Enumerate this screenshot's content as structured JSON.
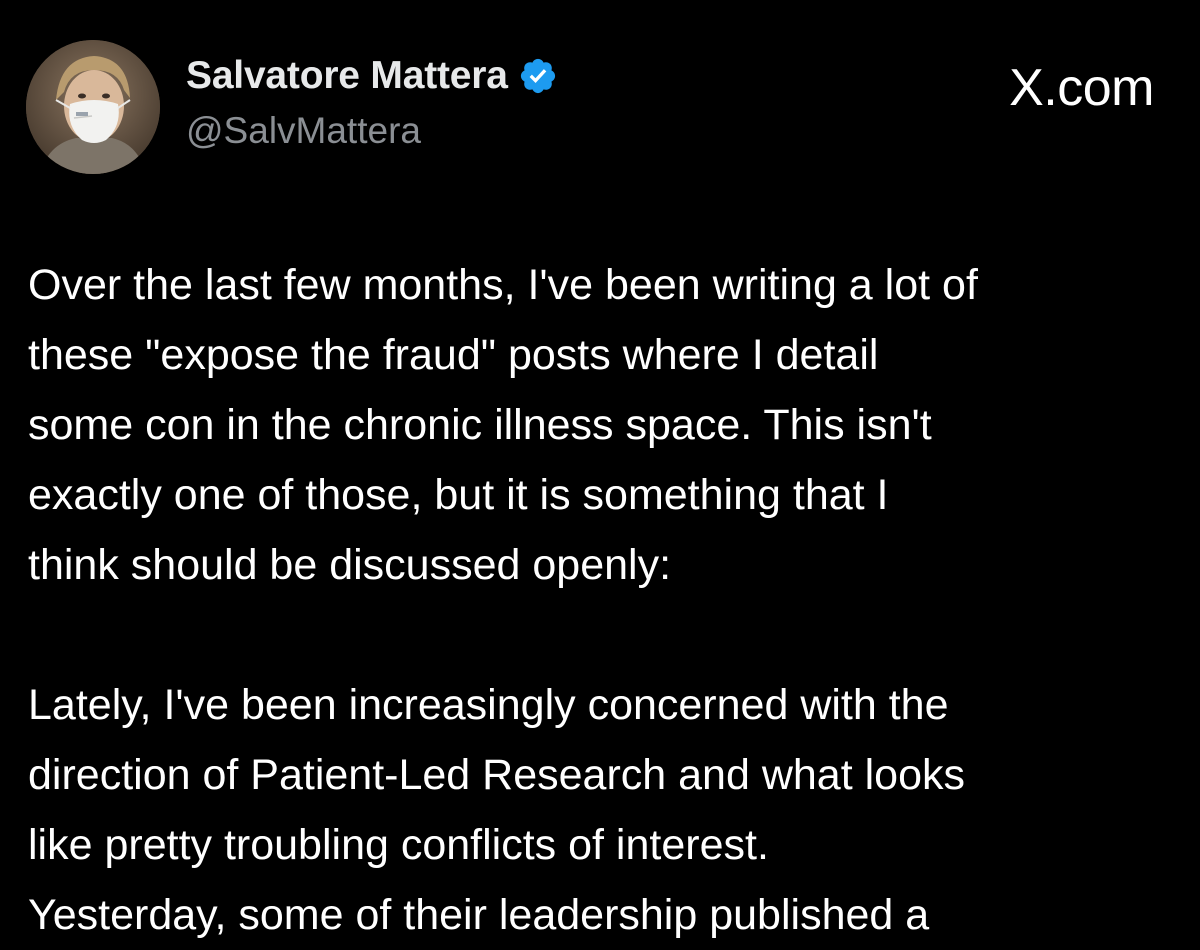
{
  "source_label": "X.com",
  "author": {
    "name": "Salvatore Mattera",
    "handle": "@SalvMattera",
    "verified": true
  },
  "icons": {
    "verified": "verified-badge-icon",
    "avatar": "avatar-photo"
  },
  "colors": {
    "background": "#000000",
    "text": "#ffffff",
    "secondary_text": "#8b8f94",
    "verified_badge": "#1d9bf0"
  },
  "post": {
    "paragraph1": [
      "Over the last few months, I've been writing a lot of",
      "these \"expose the fraud\" posts where I detail",
      "some con in the chronic illness space. This isn't",
      "exactly one of those, but it is something that I",
      "think should be discussed openly:"
    ],
    "paragraph2": [
      "Lately, I've been increasingly concerned with the",
      "direction of Patient-Led Research and what looks",
      "like pretty troubling conflicts of interest.",
      "Yesterday, some of their leadership published a"
    ]
  }
}
